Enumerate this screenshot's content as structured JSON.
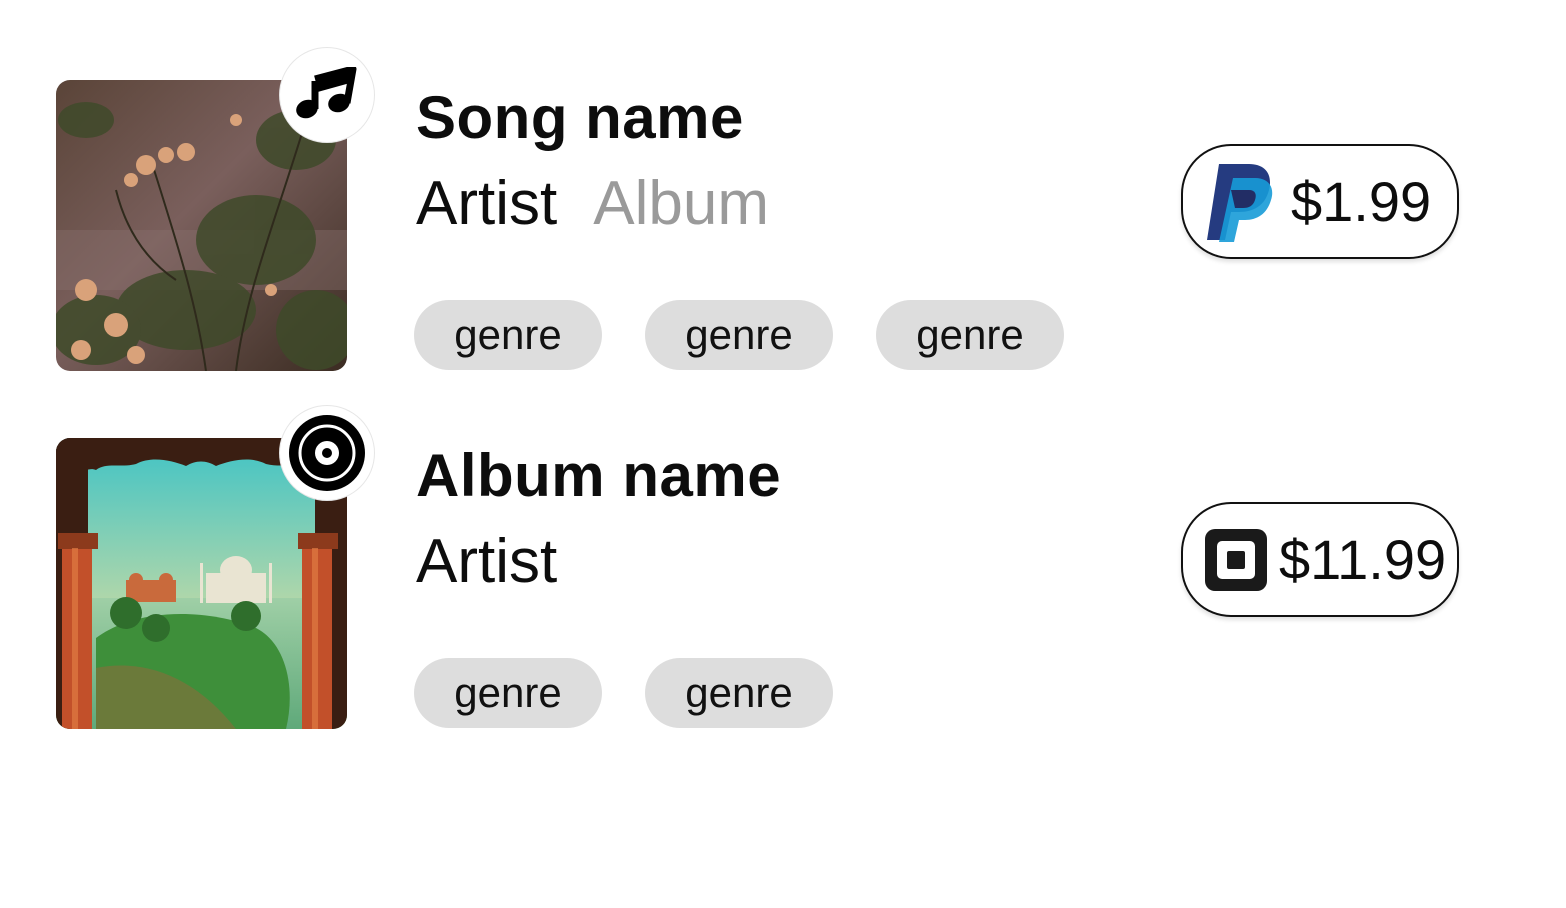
{
  "items": [
    {
      "type": "song",
      "type_icon": "music-note-icon",
      "cover": "rose-bush-cover",
      "title": "Song name",
      "artist": "Artist",
      "album": "Album",
      "genres": [
        "genre",
        "genre",
        "genre"
      ],
      "payment_icon": "paypal-icon",
      "price": "$1.99"
    },
    {
      "type": "album",
      "type_icon": "vinyl-disc-icon",
      "cover": "taj-mahal-arch-cover",
      "title": "Album name",
      "artist": "Artist",
      "genres": [
        "genre",
        "genre"
      ],
      "payment_icon": "square-icon",
      "price": "$11.99"
    }
  ],
  "colors": {
    "genre_chip": "#dddddd",
    "muted_text": "#9a9a9a",
    "paypal_dark": "#253b80",
    "paypal_light": "#179bd7",
    "square_black": "#1a1a1a"
  }
}
